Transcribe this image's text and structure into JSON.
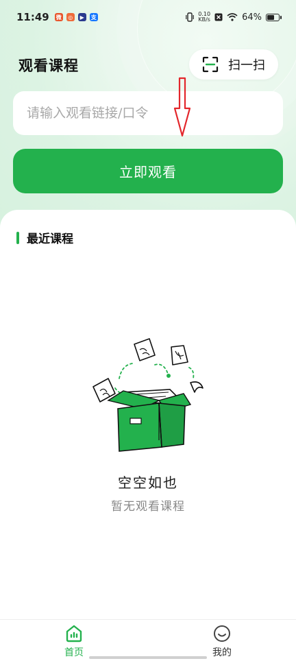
{
  "status_bar": {
    "time": "11:49",
    "apps": [
      {
        "icon": "weibo-app-icon",
        "color": "#e8542b",
        "glyph": "微"
      },
      {
        "icon": "browser-app-icon",
        "color": "#ef6b3a",
        "glyph": "◎"
      },
      {
        "icon": "video-app-icon",
        "color": "#2a3b8f",
        "glyph": "▶"
      },
      {
        "icon": "alipay-app-icon",
        "color": "#1677ff",
        "glyph": "支"
      }
    ],
    "net_speed_value": "0.10",
    "net_speed_unit": "KB/s",
    "battery": "64%",
    "battery_level": 0.64
  },
  "header": {
    "title": "观看课程",
    "scan_label": "扫一扫"
  },
  "link_input": {
    "placeholder": "请输入观看链接/口令",
    "value": ""
  },
  "watch_button": {
    "label": "立即观看"
  },
  "recent": {
    "title": "最近课程",
    "empty_title": "空空如也",
    "empty_subtitle": "暂无观看课程"
  },
  "tabs": [
    {
      "label": "首页",
      "icon": "home-icon",
      "active": true
    },
    {
      "label": "我的",
      "icon": "profile-icon",
      "active": false
    }
  ],
  "colors": {
    "accent": "#23b14d",
    "annotation": "#e3262b"
  }
}
